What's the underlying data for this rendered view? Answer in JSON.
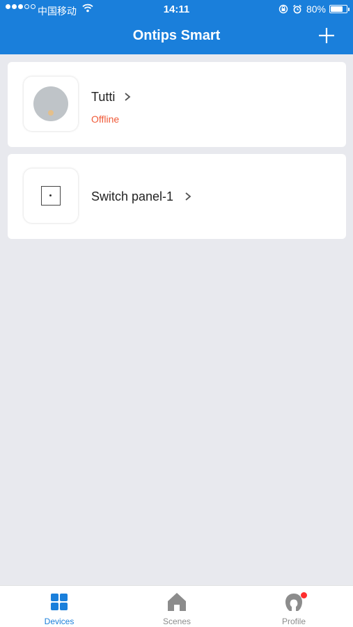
{
  "status_bar": {
    "carrier": "中国移动",
    "time": "14:11",
    "battery_percent": "80%",
    "battery_level": 0.8,
    "signal_bars_filled": 3,
    "signal_bars_total": 5
  },
  "header": {
    "title": "Ontips Smart",
    "add_icon": "plus-icon"
  },
  "devices": [
    {
      "name": "Tutti",
      "status": "Offline",
      "status_color": "#f05a38",
      "icon": "smart-lock-icon"
    },
    {
      "name": "Switch panel-1",
      "status": "",
      "icon": "switch-panel-icon"
    }
  ],
  "tabs": [
    {
      "label": "Devices",
      "icon": "grid-icon",
      "active": true
    },
    {
      "label": "Scenes",
      "icon": "home-icon",
      "active": false
    },
    {
      "label": "Profile",
      "icon": "profile-icon",
      "active": false,
      "badge": true
    }
  ],
  "colors": {
    "brand": "#1a7fdb",
    "tab_active": "#1a7fdb",
    "tab_inactive": "#8c8c8c",
    "background": "#e8e9ee",
    "offline": "#f05a38"
  }
}
